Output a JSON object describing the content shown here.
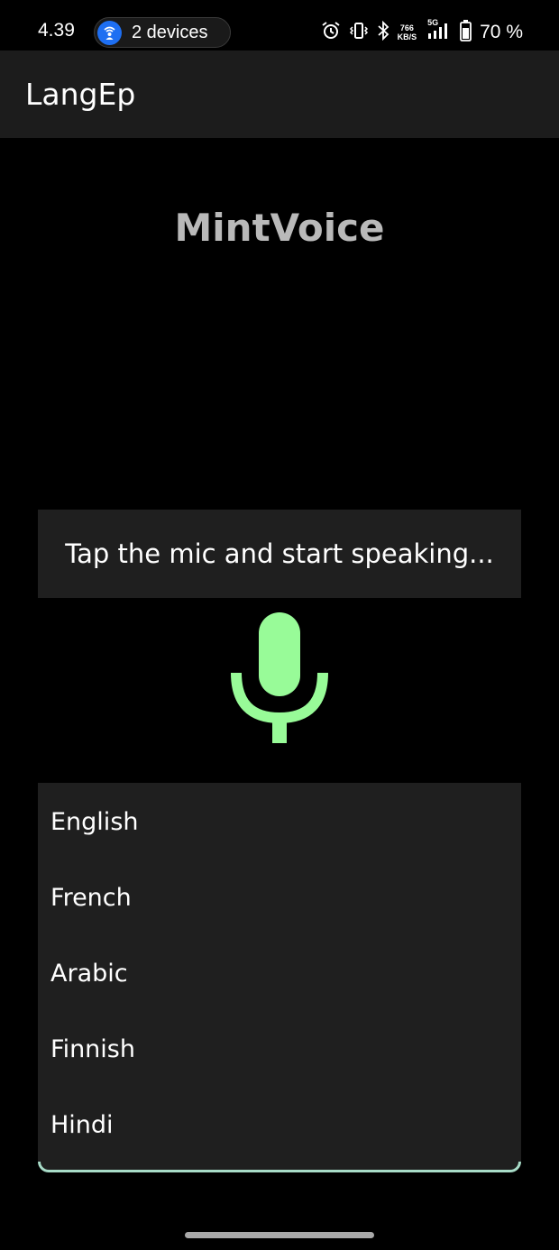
{
  "status_bar": {
    "time": "4.39",
    "devices_label": "2 devices",
    "net_speed_value": "766",
    "net_speed_unit": "KB/S",
    "network_type": "5G",
    "battery": "70 %",
    "icons": [
      "alarm-icon",
      "vibrate-icon",
      "bluetooth-icon",
      "signal-icon",
      "battery-icon"
    ]
  },
  "app_bar": {
    "title": "LangEp"
  },
  "brand": {
    "name": "MintVoice"
  },
  "prompt": {
    "text": "Tap the mic and start speaking..."
  },
  "mic": {
    "icon": "microphone-icon",
    "color": "#98fb98"
  },
  "languages": {
    "items": [
      "English",
      "French",
      "Arabic",
      "Finnish",
      "Hindi"
    ]
  },
  "colors": {
    "background": "#000000",
    "surface": "#1f1f1f",
    "accent": "#98fb98",
    "list_border": "#a8dcc8",
    "devices_badge": "#1e6ff2"
  }
}
